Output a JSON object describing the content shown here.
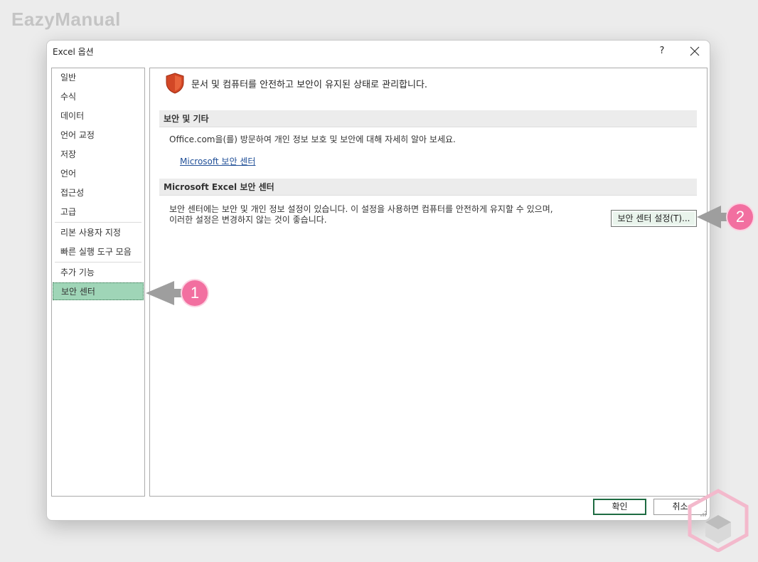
{
  "watermark": {
    "text": "EazyManual"
  },
  "dialog": {
    "title": "Excel 옵션",
    "help": "?",
    "nav": {
      "items": [
        {
          "label": "일반"
        },
        {
          "label": "수식"
        },
        {
          "label": "데이터"
        },
        {
          "label": "언어 교정"
        },
        {
          "label": "저장"
        },
        {
          "label": "언어"
        },
        {
          "label": "접근성"
        },
        {
          "label": "고급"
        },
        {
          "label": "리본 사용자 지정"
        },
        {
          "label": "빠른 실행 도구 모음"
        },
        {
          "label": "추가 기능"
        },
        {
          "label": "보안 센터",
          "selected": true
        }
      ]
    },
    "content": {
      "header": "문서 및 컴퓨터를 안전하고 보안이 유지된 상태로 관리합니다.",
      "section1": {
        "title": "보안 및 기타",
        "text": "Office.com을(를) 방문하여 개인 정보 보호 및 보안에 대해 자세히 알아 보세요.",
        "link": "Microsoft 보안 센터"
      },
      "section2": {
        "title": "Microsoft Excel 보안 센터",
        "text_line1": "보안 센터에는 보안 및 개인 정보 설정이 있습니다. 이 설정을 사용하면 컴퓨터를 안전하게 유지할 수 있으며,",
        "text_line2": "이러한 설정은 변경하지 않는 것이 좋습니다.",
        "button": "보안 센터 설정(T)..."
      }
    },
    "ok": "확인",
    "cancel": "취소"
  },
  "callouts": [
    {
      "number": "1"
    },
    {
      "number": "2"
    }
  ],
  "colors": {
    "selected_nav": "#9fd5b7",
    "shield": "#d24726",
    "callout_badge": "#f26fa0",
    "callout_arrow": "#9e9e9e"
  },
  "icons": [
    "shield-icon",
    "close-icon",
    "arrow-left-icon",
    "resize-grip-icon",
    "cube-logo-icon"
  ]
}
